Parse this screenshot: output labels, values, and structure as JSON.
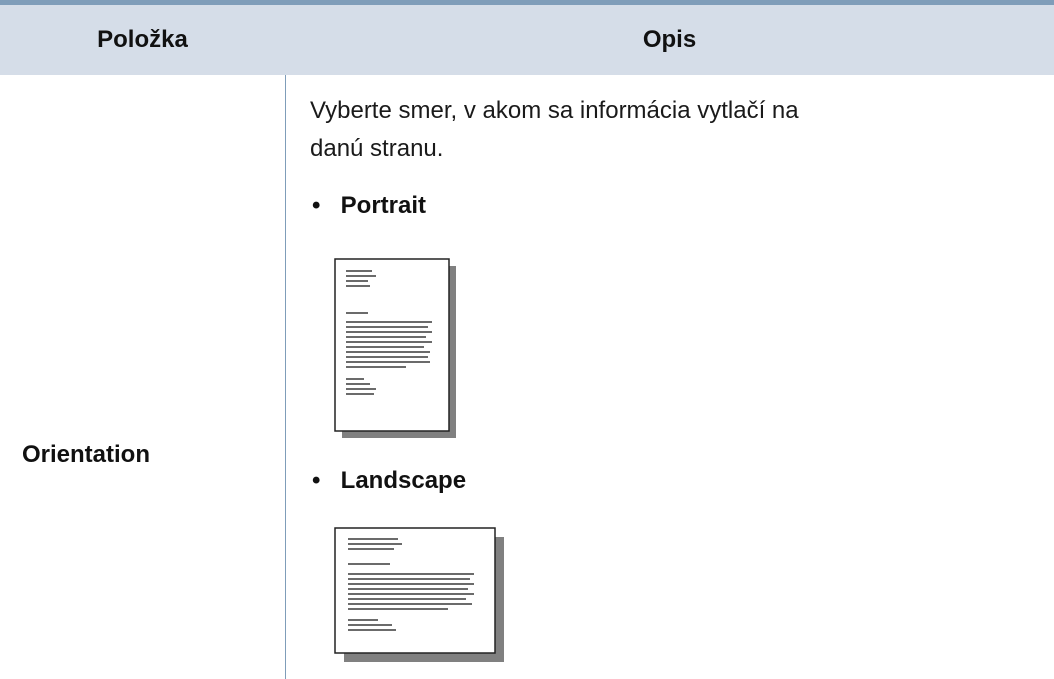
{
  "table": {
    "header": {
      "item": "Položka",
      "description": "Opis"
    },
    "rows": [
      {
        "item": "Orientation",
        "description": "Vyberte smer, v akom sa informácia vytlačí na danú stranu.",
        "options": [
          {
            "bullet": "•",
            "label": "Portrait",
            "icon": "portrait-page-icon"
          },
          {
            "bullet": "•",
            "label": "Landscape",
            "icon": "landscape-page-icon"
          }
        ]
      }
    ]
  },
  "colors": {
    "rule": "#7f9db9",
    "header_bg": "#d5dde8",
    "shadow": "#808080"
  }
}
